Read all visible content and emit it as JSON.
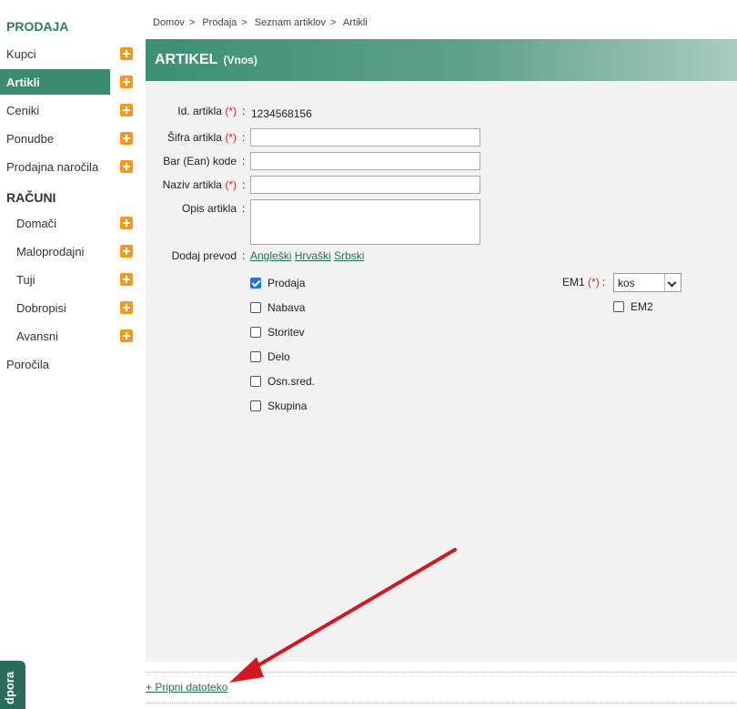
{
  "sidebar": {
    "section_prodaja": "PRODAJA",
    "section_racuni": "RAČUNI",
    "prodaja_items": [
      {
        "label": "Kupci"
      },
      {
        "label": "Artikli"
      },
      {
        "label": "Ceniki"
      },
      {
        "label": "Ponudbe"
      },
      {
        "label": "Prodajna naročila"
      }
    ],
    "racuni_items": [
      {
        "label": "Domači"
      },
      {
        "label": "Maloprodajni"
      },
      {
        "label": "Tuji"
      },
      {
        "label": "Dobropisi"
      },
      {
        "label": "Avansni"
      }
    ],
    "porocila": "Poročila",
    "support_tab": "dpora"
  },
  "breadcrumb": [
    "Domov",
    "Prodaja",
    "Seznam artiklov",
    "Artikli"
  ],
  "breadcrumb_sep": ">",
  "header": {
    "title": "ARTIKEL",
    "subtitle": "(Vnos)"
  },
  "form": {
    "required_mark": "(*)",
    "id_label": "Id. artikla",
    "id_value": "1234568156",
    "sifra_label": "Šifra artikla",
    "sifra_value": "",
    "ean_label": "Bar (Ean) kode",
    "ean_value": "",
    "naziv_label": "Naziv artikla",
    "naziv_value": "",
    "opis_label": "Opis artikla",
    "opis_value": "",
    "prevod_label": "Dodaj prevod",
    "prevod_links": [
      "Angleški",
      "Hrvaški",
      "Srbski"
    ],
    "checkboxes": [
      {
        "label": "Prodaja",
        "checked": true
      },
      {
        "label": "Nabava",
        "checked": false
      },
      {
        "label": "Storitev",
        "checked": false
      },
      {
        "label": "Delo",
        "checked": false
      },
      {
        "label": "Osn.sred.",
        "checked": false
      },
      {
        "label": "Skupina",
        "checked": false
      }
    ],
    "em1_label": "EM1",
    "em1_value": "kos",
    "em2_label": "EM2",
    "em2_checked": false
  },
  "attach_link": "+ Pripni datoteko",
  "colors": {
    "accent": "#3b8a72",
    "plus": "#f39a1e",
    "required": "#d9232d",
    "arrow": "#d11a1f"
  }
}
